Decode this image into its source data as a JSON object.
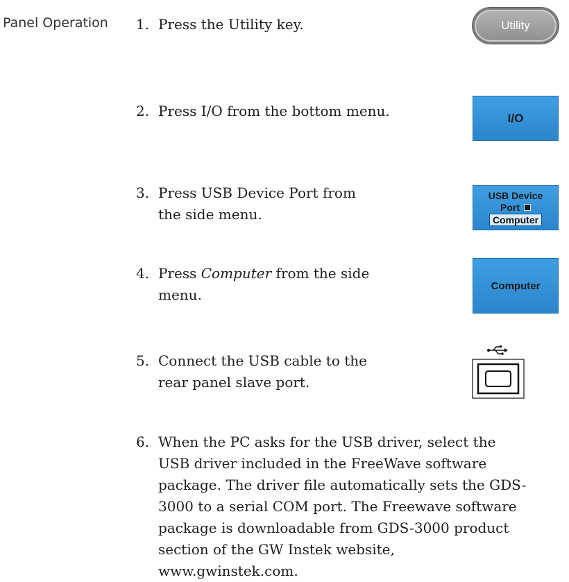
{
  "section_label": "Panel Operation",
  "steps": [
    {
      "num": "1.",
      "text": "Press the Utility key."
    },
    {
      "num": "2.",
      "text": "Press I/O from the bottom menu."
    },
    {
      "num": "3.",
      "text": "Press USB Device Port from the side menu."
    },
    {
      "num": "4.",
      "pre": "Press ",
      "emph": "Computer",
      "post": " from the side menu."
    },
    {
      "num": "5.",
      "text": "Connect the USB cable to the rear panel slave port."
    },
    {
      "num": "6.",
      "text": "When the PC asks for the USB driver, select the USB driver included in the FreeWave software package. The driver file automatically sets the GDS-3000 to a serial COM port. The Freewave software package is downloadable from GDS-3000 product section of the GW Instek website, www.gwinstek.com."
    }
  ],
  "keys": {
    "utility": "Utility",
    "io": "I/O",
    "usb_device_line1": "USB Device",
    "usb_device_line2": "Port",
    "usb_device_selected": "Computer",
    "computer": "Computer"
  },
  "icons": {
    "usb_port": "usb-b-port-icon",
    "usb_symbol": "usb-trident-icon"
  },
  "colors": {
    "menu_key_blue": "#3f9ee2",
    "utility_key_gray": "#a3a3a3"
  }
}
